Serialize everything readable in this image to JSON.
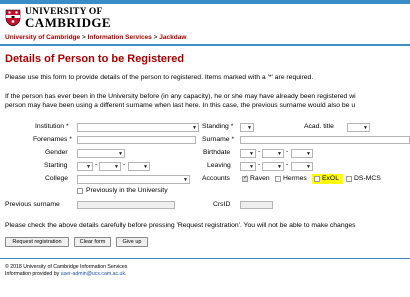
{
  "header": {
    "logo_line1": "UNIVERSITY OF",
    "logo_line2": "CAMBRIDGE",
    "breadcrumb": [
      "University of Cambridge",
      "Information Services",
      "Jackdaw"
    ],
    "breadcrumb_sep": " > "
  },
  "page": {
    "title": "Details of Person to be Registered",
    "intro": "Please use this form to provide details of the person to registered. Items marked with a '*' are required.",
    "note_line1": "If the person has ever been in the University before (in any capacity), he or she may have already been registered wi",
    "note_line2": "person may have been using a different surname when last here. In this case, the previous surname would also be u"
  },
  "form": {
    "institution_label": "Institution",
    "forenames_label": "Forenames",
    "gender_label": "Gender",
    "starting_label": "Starting",
    "college_label": "College",
    "previously_label": "Previously in the University",
    "previous_surname_label": "Previous surname",
    "standing_label": "Standing",
    "surname_label": "Surname",
    "birthdate_label": "Birthdate",
    "leaving_label": "Leaving",
    "accounts_label": "Accounts",
    "crsid_label": "CrsID",
    "acad_title_label": "Acad. title",
    "required_mark": "*",
    "date_sep": "-",
    "accounts": [
      {
        "label": "Raven",
        "checked": true
      },
      {
        "label": "Hermes",
        "checked": false
      },
      {
        "label": "ExOL",
        "checked": false,
        "highlight": true
      },
      {
        "label": "DS-MCS",
        "checked": false
      }
    ],
    "highlight_color": "#ffff00"
  },
  "footer_text": "Please check the above details carefully before pressing 'Request registration'. You will not be able to make changes",
  "buttons": {
    "request": "Request registration",
    "clear": "Clear form",
    "give_up": "Give up"
  },
  "page_footer": {
    "copyright": "© 2018 University of Cambridge Information Services",
    "provided_by": "Information provided by",
    "email": "user-admin@ucs.cam.ac.uk."
  },
  "colors": {
    "accent": "#3a8dc7",
    "title": "#aa0000"
  }
}
